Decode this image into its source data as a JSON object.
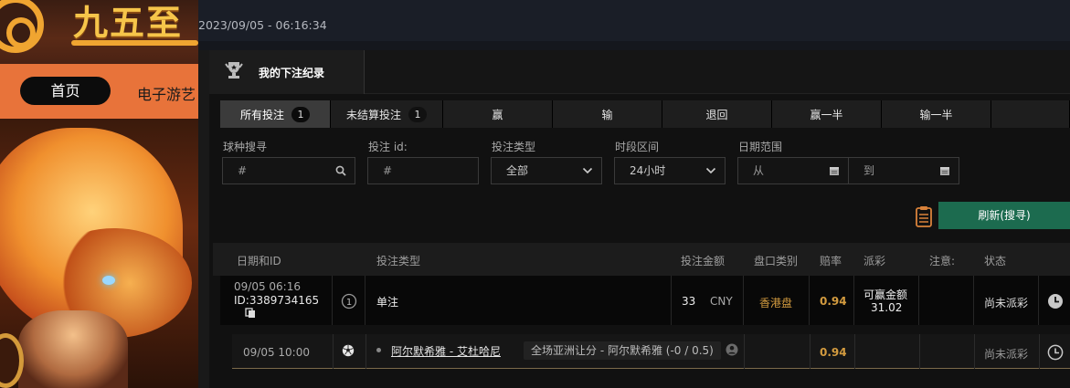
{
  "site": {
    "logo_text": "九五至",
    "nav": {
      "home": "首页",
      "item2": "电子游艺"
    },
    "datetime": "2023/09/05 - 06:16:34"
  },
  "panel": {
    "title": "我的下注纪录",
    "filter_tabs": [
      {
        "label": "所有投注",
        "count": "1"
      },
      {
        "label": "未结算投注",
        "count": "1"
      },
      {
        "label": "赢"
      },
      {
        "label": "输"
      },
      {
        "label": "退回"
      },
      {
        "label": "赢一半"
      },
      {
        "label": "输一半"
      }
    ],
    "filters": {
      "sport_search": {
        "label": "球种搜寻",
        "placeholder": "#"
      },
      "bet_id": {
        "label": "投注 id:",
        "placeholder": "#"
      },
      "bet_type": {
        "label": "投注类型",
        "value": "全部"
      },
      "time_range": {
        "label": "时段区间",
        "value": "24小时"
      },
      "date_range": {
        "label": "日期范围",
        "from": "从",
        "to": "到"
      }
    },
    "refresh_label": "刷新(搜寻)",
    "columns": {
      "date_id": "日期和ID",
      "bet_type": "投注类型",
      "amount": "投注金额",
      "odds_type": "盘口类别",
      "odds": "赔率",
      "payout": "派彩",
      "note": "注意:",
      "status": "状态"
    },
    "bet": {
      "date": "09/05 06:16",
      "id": "ID:3389734165",
      "leg_count": "1",
      "type": "单注",
      "amount": "33",
      "currency": "CNY",
      "odds_type": "香港盘",
      "odds": "0.94",
      "payout_label": "可赢金额",
      "payout_value": "31.02",
      "status": "尚未派彩"
    },
    "selection": {
      "date": "09/05 10:00",
      "match": "阿尔默希雅 - 艾杜哈尼",
      "market": "全场亚洲让分 - 阿尔默希雅 (-0 / 0.5)",
      "odds": "0.94",
      "status": "尚未派彩"
    }
  },
  "colors": {
    "accent_green": "#1c6b4f",
    "odds_gold": "#d39b3f",
    "nav_orange": "#e8733a"
  }
}
